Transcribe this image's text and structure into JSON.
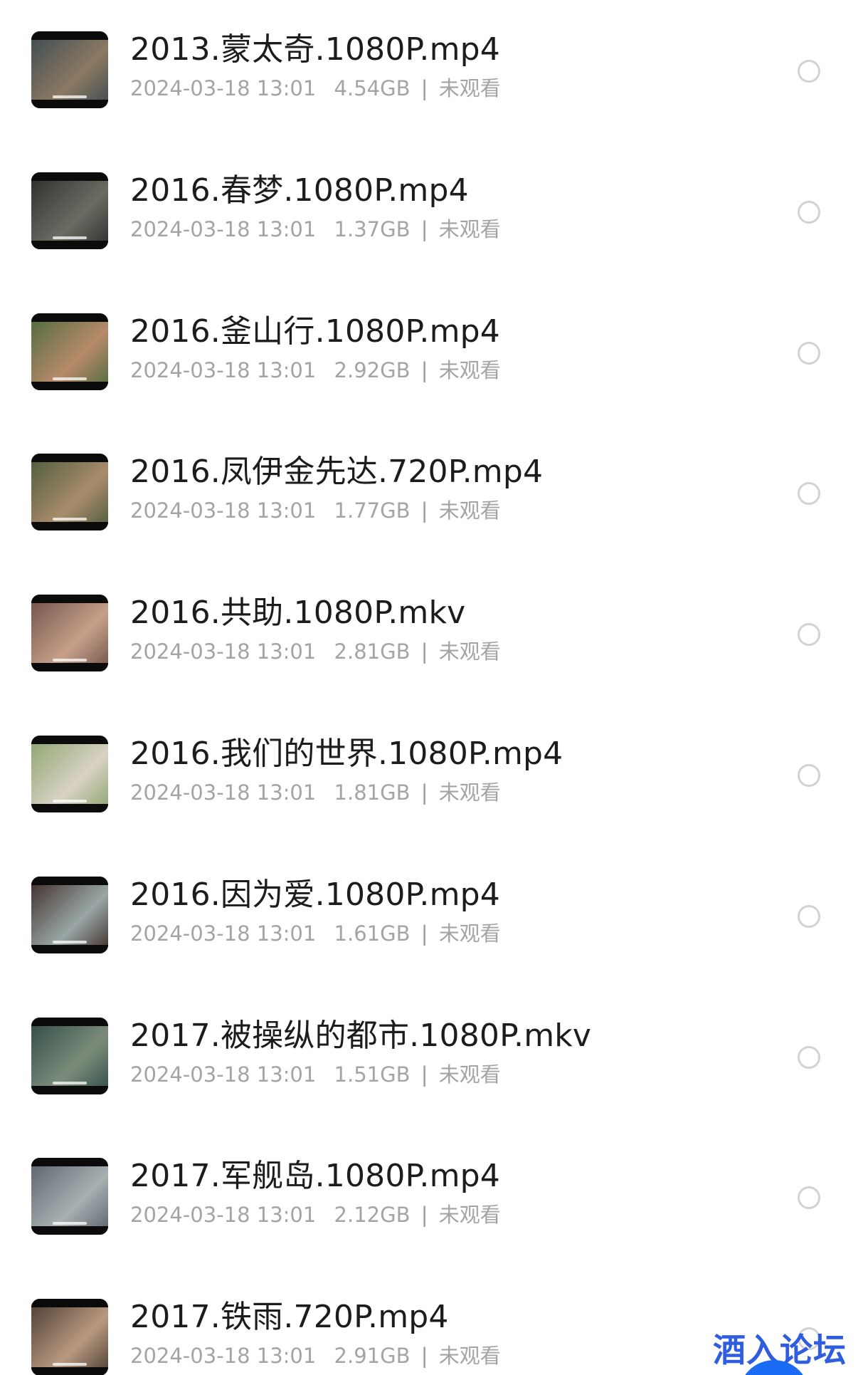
{
  "files": [
    {
      "name": "2013.蒙太奇.1080P.mp4",
      "date": "2024-03-18 13:01",
      "size": "4.54GB",
      "separator": "|",
      "status": "未观看",
      "thumb": [
        "#3b4a52",
        "#8c7a63"
      ]
    },
    {
      "name": "2016.春梦.1080P.mp4",
      "date": "2024-03-18 13:01",
      "size": "1.37GB",
      "separator": "|",
      "status": "未观看",
      "thumb": [
        "#2a2c2b",
        "#6b6d63"
      ]
    },
    {
      "name": "2016.釜山行.1080P.mp4",
      "date": "2024-03-18 13:01",
      "size": "2.92GB",
      "separator": "|",
      "status": "未观看",
      "thumb": [
        "#4d6a3d",
        "#b78a6a"
      ]
    },
    {
      "name": "2016.凤伊金先达.720P.mp4",
      "date": "2024-03-18 13:01",
      "size": "1.77GB",
      "separator": "|",
      "status": "未观看",
      "thumb": [
        "#4b5a3e",
        "#a98c6a"
      ]
    },
    {
      "name": "2016.共助.1080P.mkv",
      "date": "2024-03-18 13:01",
      "size": "2.81GB",
      "separator": "|",
      "status": "未观看",
      "thumb": [
        "#6e5048",
        "#c7a08a"
      ]
    },
    {
      "name": "2016.我们的世界.1080P.mp4",
      "date": "2024-03-18 13:01",
      "size": "1.81GB",
      "separator": "|",
      "status": "未观看",
      "thumb": [
        "#8aa36b",
        "#d8d2c4"
      ]
    },
    {
      "name": "2016.因为爱.1080P.mp4",
      "date": "2024-03-18 13:01",
      "size": "1.61GB",
      "separator": "|",
      "status": "未观看",
      "thumb": [
        "#3a2a25",
        "#9aa7a6"
      ]
    },
    {
      "name": "2017.被操纵的都市.1080P.mkv",
      "date": "2024-03-18 13:01",
      "size": "1.51GB",
      "separator": "|",
      "status": "未观看",
      "thumb": [
        "#2f4a46",
        "#7c8c7a"
      ]
    },
    {
      "name": "2017.军舰岛.1080P.mp4",
      "date": "2024-03-18 13:01",
      "size": "2.12GB",
      "separator": "|",
      "status": "未观看",
      "thumb": [
        "#59606a",
        "#a9b0b2"
      ]
    },
    {
      "name": "2017.铁雨.720P.mp4",
      "date": "2024-03-18 13:01",
      "size": "2.91GB",
      "separator": "|",
      "status": "未观看",
      "thumb": [
        "#4a3a30",
        "#b89a80"
      ]
    }
  ],
  "watermark": "酒入论坛",
  "colors": {
    "title": "#1c1c1c",
    "meta": "#a4a4a4",
    "radio_border": "#d2d2d2",
    "watermark": "#2f5de0",
    "fab": "#1a6cf5"
  }
}
